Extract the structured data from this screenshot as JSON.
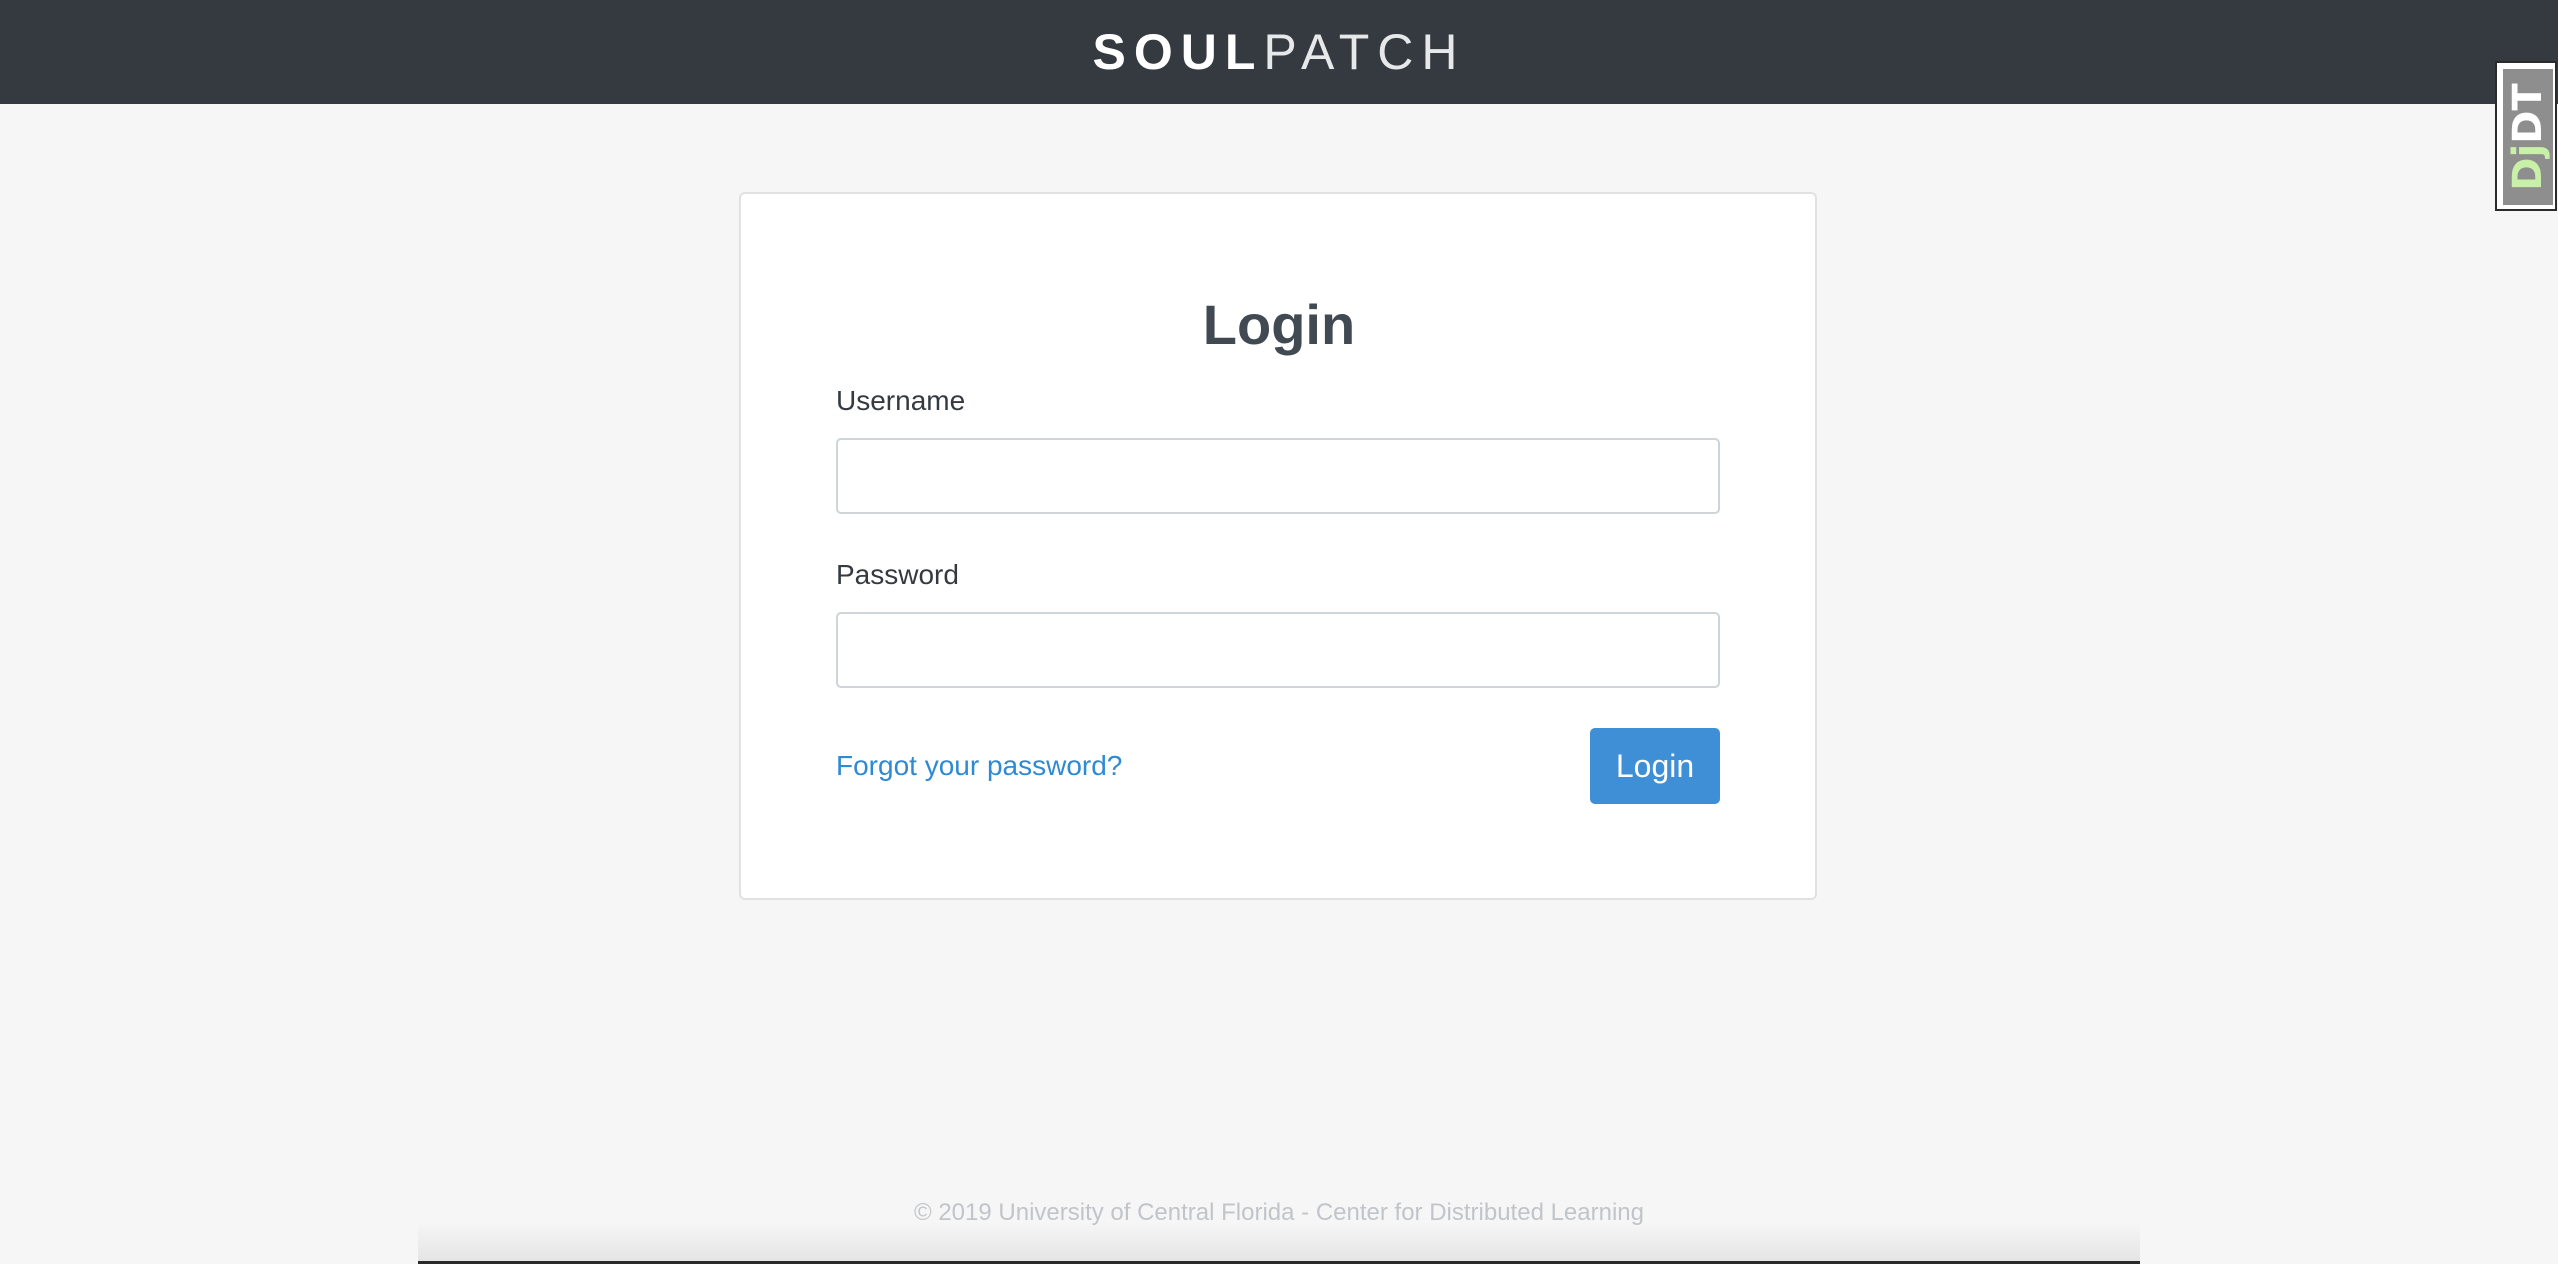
{
  "header": {
    "brand_bold": "SOUL",
    "brand_light": "PATCH"
  },
  "debug_toolbar": {
    "label_prefix": "Dj",
    "label_suffix": "DT",
    "icon": "django-debug-toolbar-handle"
  },
  "login_form": {
    "title": "Login",
    "username_label": "Username",
    "username_value": "",
    "password_label": "Password",
    "password_value": "",
    "forgot_link": "Forgot your password?",
    "submit_label": "Login"
  },
  "footer": {
    "text": "© 2019 University of Central Florida - Center for Distributed Learning"
  },
  "colors": {
    "header_bg": "#343a40",
    "page_bg": "#f6f6f6",
    "primary": "#3f8fd6",
    "link": "#2f8ad4"
  }
}
